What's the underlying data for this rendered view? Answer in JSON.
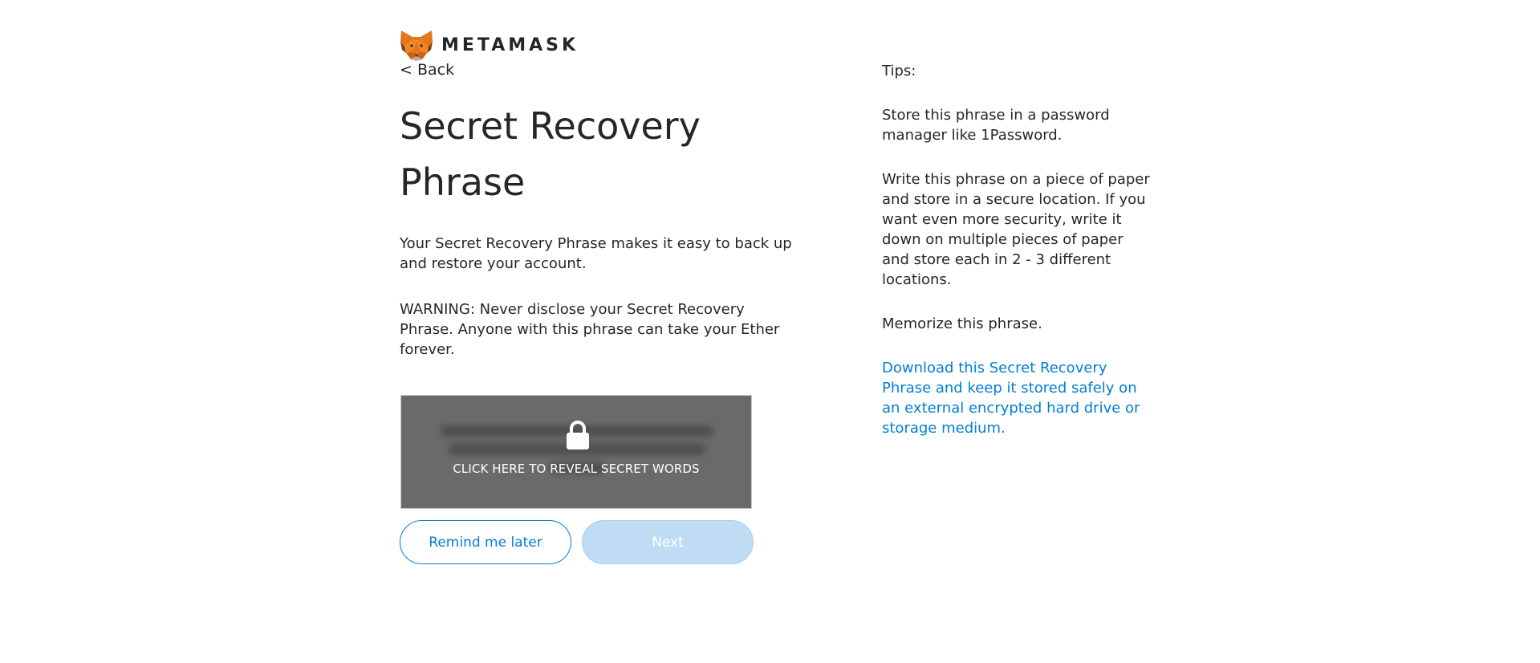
{
  "brand": {
    "logo_text": "METAMASK",
    "logo_icon": "metamask-fox-icon"
  },
  "nav": {
    "back_label": "< Back"
  },
  "main": {
    "title": "Secret Recovery Phrase",
    "description": "Your Secret Recovery Phrase makes it easy to back up and restore your account.",
    "warning": "WARNING: Never disclose your Secret Recovery Phrase. Anyone with this phrase can take your Ether forever.",
    "reveal": {
      "icon": "lock-icon",
      "label": "CLICK HERE TO REVEAL SECRET WORDS"
    },
    "buttons": {
      "remind_label": "Remind me later",
      "next_label": "Next"
    }
  },
  "tips": {
    "heading": "Tips:",
    "items": [
      "Store this phrase in a password manager like 1Password.",
      "Write this phrase on a piece of paper and store in a secure location. If you want even more security, write it down on multiple pieces of paper and store each in 2 - 3 different locations.",
      "Memorize this phrase."
    ],
    "download_link": "Download this Secret Recovery Phrase and keep it stored safely on an external encrypted hard drive or storage medium."
  },
  "colors": {
    "text": "#24272a",
    "accent": "#037dd6",
    "next_disabled_bg": "#c0dcf4",
    "reveal_overlay": "#6a6a6a"
  }
}
